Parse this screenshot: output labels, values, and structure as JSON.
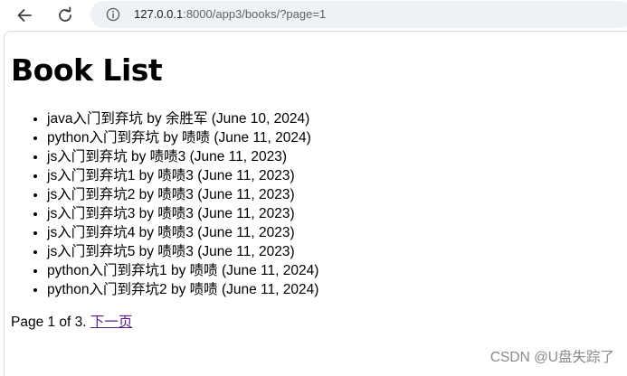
{
  "browser": {
    "url_host": "127.0.0.1",
    "url_path": ":8000/app3/books/?page=1",
    "icons": {
      "back": "arrow-left-icon",
      "reload": "reload-icon",
      "info": "info-icon"
    }
  },
  "page": {
    "title": "Book List",
    "books": [
      "java入门到弃坑 by 余胜军 (June 10, 2024)",
      "python入门到弃坑 by 啧啧 (June 11, 2024)",
      "js入门到弃坑 by 啧啧3 (June 11, 2023)",
      "js入门到弃坑1 by 啧啧3 (June 11, 2023)",
      "js入门到弃坑2 by 啧啧3 (June 11, 2023)",
      "js入门到弃坑3 by 啧啧3 (June 11, 2023)",
      "js入门到弃坑4 by 啧啧3 (June 11, 2023)",
      "js入门到弃坑5 by 啧啧3 (June 11, 2023)",
      "python入门到弃坑1 by 啧啧 (June 11, 2024)",
      "python入门到弃坑2 by 啧啧 (June 11, 2024)"
    ],
    "pagination": {
      "status": "Page 1 of 3.",
      "next_label": "下一页"
    }
  },
  "watermark": "CSDN @U盘失踪了",
  "colors": {
    "link_visited": "#551a8b",
    "url_bar_bg": "#eef1f5",
    "watermark": "#8a8a8a"
  }
}
